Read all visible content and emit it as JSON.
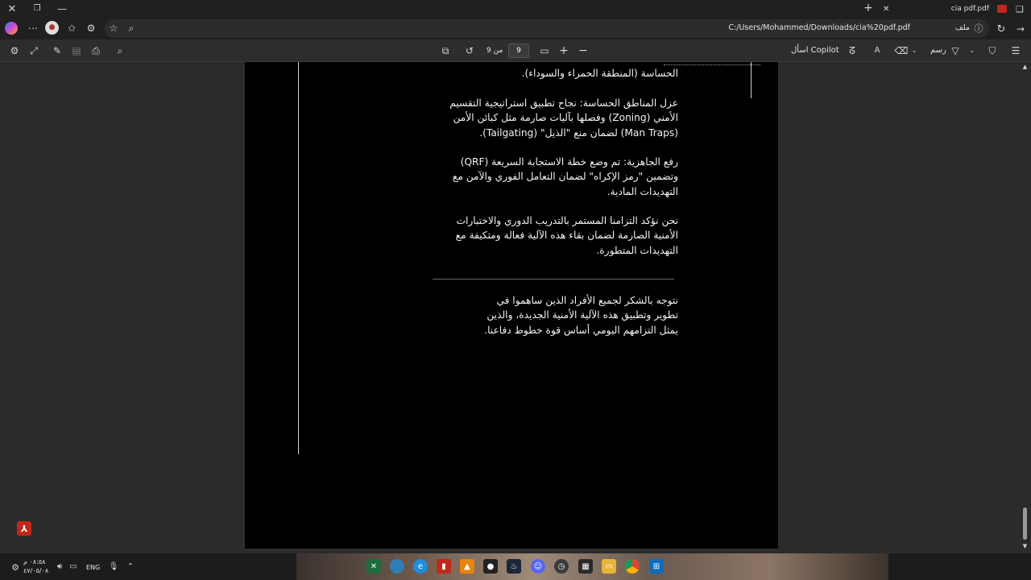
{
  "browser": {
    "tab_title": "cia pdf.pdf",
    "url_prefix": "ملف",
    "url": "C:/Users/Mohammed/Downloads/cia%20pdf.pdf"
  },
  "pdf_toolbar": {
    "current_page": "9",
    "page_of": "من 9",
    "copilot_label": "اسأل Copilot",
    "draw_label": "رسم"
  },
  "document": {
    "paragraphs": [
      "الحساسة (المنطقة الحمراء والسوداء).",
      "عزل المناطق الحساسة: نجاح تطبيق استراتيجية التقسيم\nالأمني (Zoning) وفصلها بآليات صارمة مثل كبائن الأمن\n(Man Traps) لضمان منع \"الذيل\" (Tailgating).",
      "رفع الجاهزية: تم وضع خطة الاستجابة السريعة (QRF)\nوتضمين \"رمز الإكراه\" لضمان التعامل الفوري والآمن مع\nالتهديدات المادية.",
      "نحن نؤكد التزامنا المستمر بالتدريب الدوري والاختبارات\nالأمنية الصارمة لضمان بقاء هذه الآلية فعالة ومتكيفة مع\nالتهديدات المتطورة.",
      "نتوجه بالشكر لجميع الأفراد الذين ساهموا في\nتطوير وتطبيق هذه الآلية الأمنية الجديدة، والذين\nيمثل التزامهم اليومي أساس قوة خطوط دفاعنا."
    ]
  },
  "taskbar": {
    "time": "٠٨:٥٨ م",
    "date": "٤٧/٠٥/٠٨",
    "language": "ENG"
  },
  "colors": {
    "page_bg": "#000000",
    "viewer_bg": "#2b2b2b",
    "toolbar_bg": "#2d2d2d",
    "acrobat_red": "#c0281b"
  }
}
